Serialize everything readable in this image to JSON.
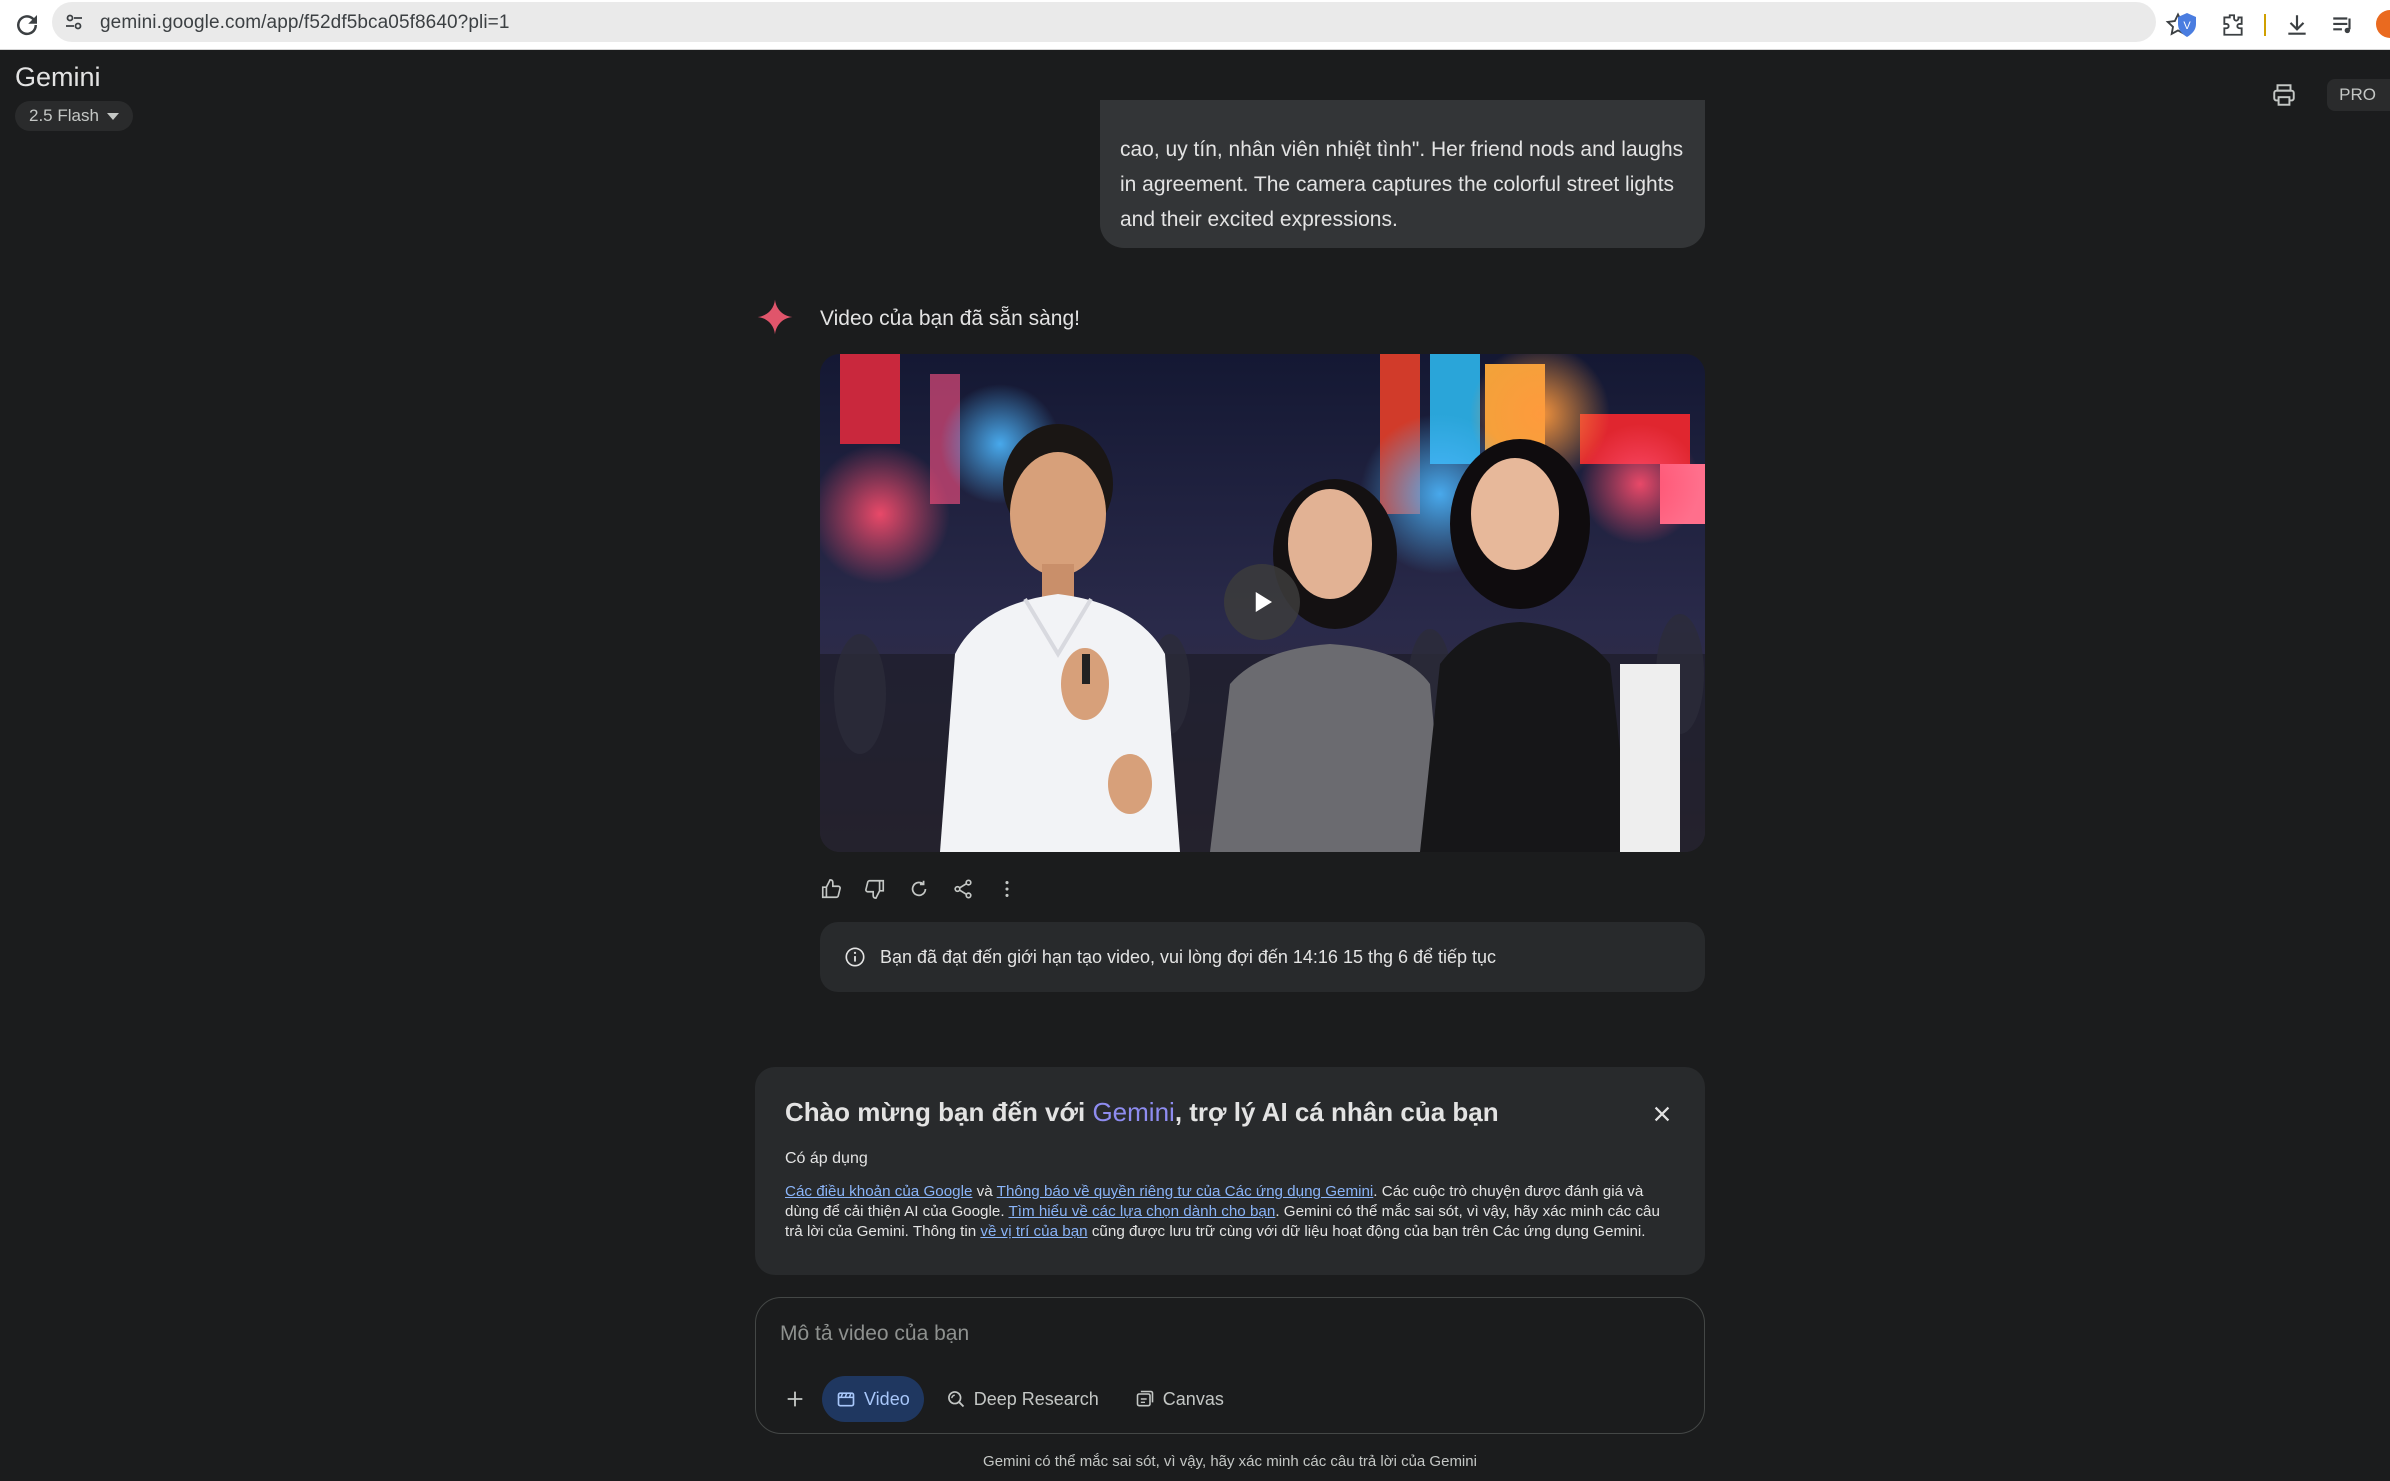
{
  "browser": {
    "url": "gemini.google.com/app/f52df5bca05f8640?pli=1",
    "icons": [
      "reload-icon",
      "site-info-icon",
      "star-icon",
      "shield-extension-icon",
      "puzzle-extension-icon",
      "download-icon",
      "playlist-icon",
      "profile-avatar"
    ]
  },
  "app": {
    "title": "Gemini",
    "model": "2.5 Flash",
    "badge": "PRO"
  },
  "conversation": {
    "user_message_visible": "cao, uy tín, nhân viên nhiệt tình\". Her friend nods and laughs in agreement. The camera captures the colorful street lights and their excited expressions.",
    "response_title": "Video của bạn đã sẵn sàng!",
    "actions": [
      "thumbs-up-icon",
      "thumbs-down-icon",
      "regenerate-icon",
      "share-icon",
      "more-vert-icon"
    ],
    "limit_notice": "Bạn đã đạt đến giới hạn tạo video, vui lòng đợi đến 14:16 15 thg 6 để tiếp tục"
  },
  "welcome": {
    "title_prefix": "Chào mừng bạn đến với ",
    "title_brand": "Gemini",
    "title_suffix": ", trợ lý AI cá nhân của bạn",
    "subtitle": "Có áp dụng",
    "link_terms": "Các điều khoản của Google",
    "text_and": " và ",
    "link_privacy": "Thông báo về quyền riêng tư của Các ứng dụng Gemini",
    "text_1": ". Các cuộc trò chuyện được đánh giá và dùng để cải thiện AI của Google. ",
    "link_choices": "Tìm hiểu về các lựa chọn dành cho bạn",
    "text_2": ". Gemini có thể mắc sai sót, vì vậy, hãy xác minh các câu trả lời của Gemini. Thông tin ",
    "link_location": "về vị trí của bạn",
    "text_3": " cũng được lưu trữ cùng với dữ liệu hoạt động của bạn trên Các ứng dụng Gemini."
  },
  "prompt": {
    "placeholder": "Mô tả video của bạn",
    "tools": {
      "video": "Video",
      "deep_research": "Deep Research",
      "canvas": "Canvas"
    }
  },
  "footer": {
    "disclaimer": "Gemini có thể mắc sai sót, vì vậy, hãy xác minh các câu trả lời của Gemini"
  },
  "colors": {
    "background": "#1b1c1d",
    "surface": "#282a2c",
    "accent_blue": "#a8c7fa",
    "brand_gradient": "#8e8cf0",
    "spark": "#e0556b"
  }
}
